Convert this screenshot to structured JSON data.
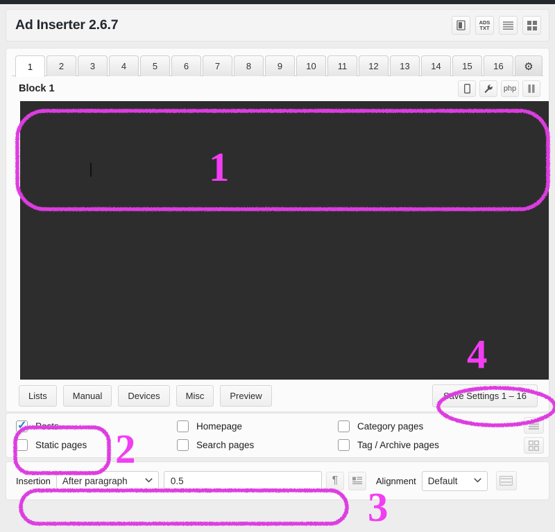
{
  "app": {
    "title": "Ad Inserter 2.6.7",
    "header_icons": [
      {
        "name": "debug-book-icon",
        "glyph": "▐▌"
      },
      {
        "name": "ads-txt-icon",
        "line1": "ADS",
        "line2": "TXT"
      },
      {
        "name": "list-view-icon",
        "glyph": "☰"
      },
      {
        "name": "grid-view-icon",
        "glyph": "░"
      }
    ]
  },
  "tabs": {
    "items": [
      "1",
      "2",
      "3",
      "4",
      "5",
      "6",
      "7",
      "8",
      "9",
      "10",
      "11",
      "12",
      "13",
      "14",
      "15",
      "16"
    ],
    "active": "1",
    "settings_tab": {
      "name": "settings-gear-tab",
      "glyph": "⚙"
    }
  },
  "block": {
    "title": "Block 1",
    "icons": [
      {
        "name": "device-icon",
        "glyph": "□"
      },
      {
        "name": "wrench-icon",
        "glyph": "ὒ7"
      },
      {
        "name": "php-icon",
        "label": "php"
      },
      {
        "name": "pause-icon",
        "glyph": "‖"
      }
    ],
    "editor": {
      "content": "",
      "background_color": "#2d2d2d",
      "caret_visible": true
    }
  },
  "buttons": {
    "lists": "Lists",
    "manual": "Manual",
    "devices": "Devices",
    "misc": "Misc",
    "preview": "Preview",
    "save": "Save Settings 1 – 16"
  },
  "display_options": {
    "columns": [
      [
        {
          "label": "Posts",
          "checked": true
        },
        {
          "label": "Static pages",
          "checked": false
        }
      ],
      [
        {
          "label": "Homepage",
          "checked": false
        },
        {
          "label": "Search pages",
          "checked": false
        }
      ],
      [
        {
          "label": "Category pages",
          "checked": false
        },
        {
          "label": "Tag / Archive pages",
          "checked": false
        }
      ]
    ],
    "side_icons": [
      {
        "name": "lists-toggle-icon",
        "glyph": "☰"
      },
      {
        "name": "blocks-toggle-icon",
        "glyph": "▦"
      }
    ]
  },
  "insertion": {
    "label": "Insertion",
    "selected": "After paragraph",
    "value": "0.5",
    "paragraph_icon": "¶",
    "alignment_label": "Alignment",
    "alignment_selected": "Default",
    "chevron": "⌄"
  },
  "annotations": {
    "accent_color": "#f23ef2",
    "marks": [
      {
        "id": "1",
        "label": "1",
        "shape": "ellipse",
        "target": "code-editor-top"
      },
      {
        "id": "2",
        "label": "2",
        "shape": "rounded-rect",
        "target": "posts-checkboxes"
      },
      {
        "id": "3",
        "label": "3",
        "shape": "ellipse",
        "target": "insertion-controls"
      },
      {
        "id": "4",
        "label": "4",
        "shape": "ellipse",
        "target": "save-settings-button"
      }
    ]
  }
}
